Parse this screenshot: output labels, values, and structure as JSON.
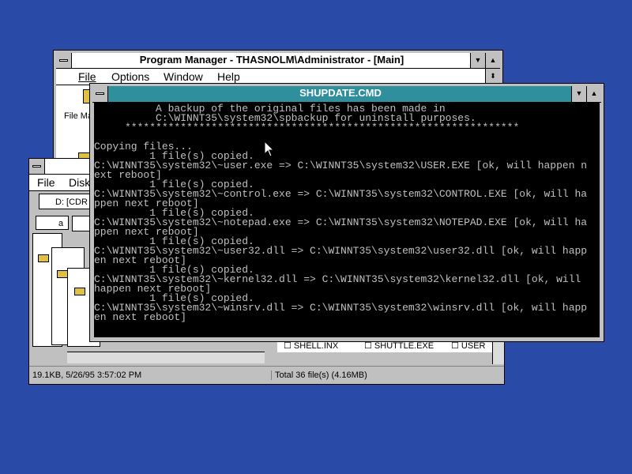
{
  "program_manager": {
    "title": "Program Manager - THASNOLM\\Administrator - [Main]",
    "menu": [
      "File",
      "Options",
      "Window",
      "Help"
    ],
    "icon_label": "File Ma"
  },
  "file_manager": {
    "menu": [
      "File",
      "Disk"
    ],
    "drive_label": "D: [CDR",
    "drive_a": "a",
    "files": [
      "SHELL.INX",
      "SHUTTLE.EXE",
      "USER"
    ],
    "status_left": "19.1KB, 5/26/95 3:57:02 PM",
    "status_right": "Total 36 file(s) (4.16MB)"
  },
  "console": {
    "title": "SHUPDATE.CMD",
    "lines": [
      "          A backup of the original files has been made in",
      "          C:\\WINNT35\\system32\\spbackup for uninstall purposes.",
      "     ****************************************************************",
      "",
      "Copying files...",
      "         1 file(s) copied.",
      "C:\\WINNT35\\system32\\~user.exe => C:\\WINNT35\\system32\\USER.EXE [ok, will happen n",
      "ext reboot]",
      "         1 file(s) copied.",
      "C:\\WINNT35\\system32\\~control.exe => C:\\WINNT35\\system32\\CONTROL.EXE [ok, will ha",
      "ppen next reboot]",
      "         1 file(s) copied.",
      "C:\\WINNT35\\system32\\~notepad.exe => C:\\WINNT35\\system32\\NOTEPAD.EXE [ok, will ha",
      "ppen next reboot]",
      "         1 file(s) copied.",
      "C:\\WINNT35\\system32\\~user32.dll => C:\\WINNT35\\system32\\user32.dll [ok, will happ",
      "en next reboot]",
      "         1 file(s) copied.",
      "C:\\WINNT35\\system32\\~kernel32.dll => C:\\WINNT35\\system32\\kernel32.dll [ok, will",
      "happen next reboot]",
      "         1 file(s) copied.",
      "C:\\WINNT35\\system32\\~winsrv.dll => C:\\WINNT35\\system32\\winsrv.dll [ok, will happ",
      "en next reboot]"
    ]
  },
  "colors": {
    "desktop": "#2a4aa8",
    "active_title": "#2f8f9c",
    "console_bg": "#000000",
    "console_fg": "#c0c0c0"
  }
}
